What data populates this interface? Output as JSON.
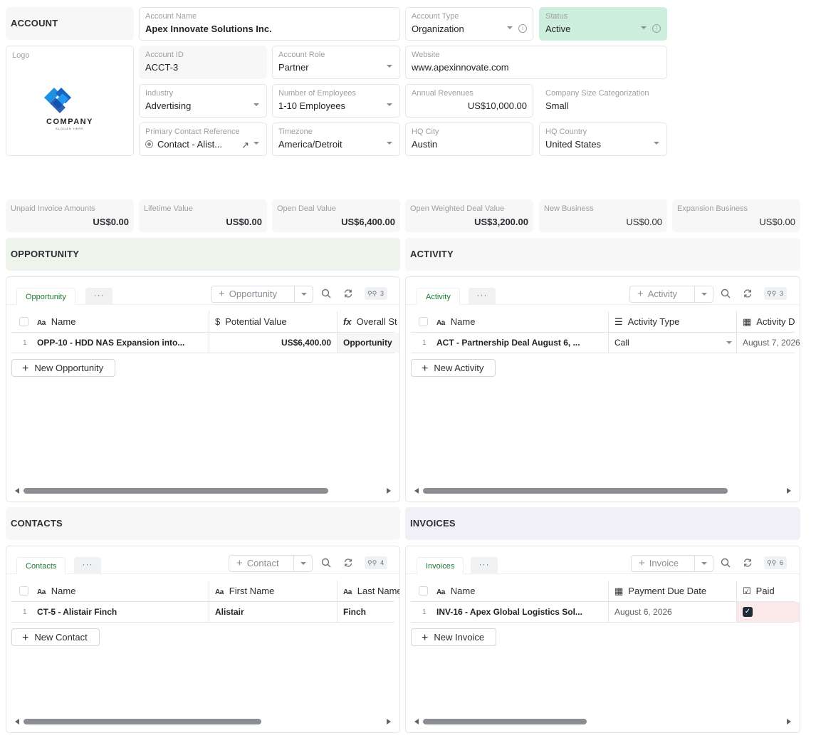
{
  "account": {
    "section_title": "ACCOUNT",
    "account_name": {
      "label": "Account Name",
      "value": "Apex Innovate Solutions Inc."
    },
    "account_type": {
      "label": "Account Type",
      "value": "Organization"
    },
    "status": {
      "label": "Status",
      "value": "Active"
    },
    "logo": {
      "label": "Logo",
      "brand": "COMPANY",
      "slogan": "SLOGAN HERE"
    },
    "account_id": {
      "label": "Account ID",
      "value": "ACCT-3"
    },
    "account_role": {
      "label": "Account Role",
      "value": "Partner"
    },
    "website": {
      "label": "Website",
      "value": "www.apexinnovate.com"
    },
    "industry": {
      "label": "Industry",
      "value": "Advertising"
    },
    "employees": {
      "label": "Number of Employees",
      "value": "1-10 Employees"
    },
    "annual_revenues": {
      "label": "Annual Revenues",
      "value": "US$10,000.00"
    },
    "size_category": {
      "label": "Company Size Categorization",
      "value": "Small"
    },
    "primary_contact": {
      "label": "Primary Contact Reference",
      "value": "Contact - Alist..."
    },
    "timezone": {
      "label": "Timezone",
      "value": "America/Detroit"
    },
    "hq_city": {
      "label": "HQ City",
      "value": "Austin"
    },
    "hq_country": {
      "label": "HQ Country",
      "value": "United States"
    }
  },
  "metrics": [
    {
      "label": "Unpaid Invoice Amounts",
      "value": "US$0.00"
    },
    {
      "label": "Lifetime Value",
      "value": "US$0.00"
    },
    {
      "label": "Open Deal Value",
      "value": "US$6,400.00"
    },
    {
      "label": "Open Weighted Deal Value",
      "value": "US$3,200.00"
    },
    {
      "label": "New Business",
      "value": "US$0.00"
    },
    {
      "label": "Expansion Business",
      "value": "US$0.00"
    }
  ],
  "opportunity": {
    "section_title": "OPPORTUNITY",
    "tab": "Opportunity",
    "more": "···",
    "add_label": "Opportunity",
    "filter_count": "3",
    "columns": [
      "Name",
      "Potential Value",
      "Overall St"
    ],
    "row": {
      "num": "1",
      "name": "OPP-10 - HDD NAS Expansion into...",
      "value": "US$6,400.00",
      "stage": "Opportunity"
    },
    "new_label": "New Opportunity"
  },
  "activity": {
    "section_title": "ACTIVITY",
    "tab": "Activity",
    "more": "···",
    "add_label": "Activity",
    "filter_count": "3",
    "columns": [
      "Name",
      "Activity Type",
      "Activity D"
    ],
    "row": {
      "num": "1",
      "name": "ACT - Partnership Deal August 6, ...",
      "type": "Call",
      "date": "August 7, 2026"
    },
    "new_label": "New Activity"
  },
  "contacts": {
    "section_title": "CONTACTS",
    "tab": "Contacts",
    "more": "···",
    "add_label": "Contact",
    "filter_count": "4",
    "columns": [
      "Name",
      "First Name",
      "Last Name"
    ],
    "row": {
      "num": "1",
      "name": "CT-5 - Alistair Finch",
      "first": "Alistair",
      "last": "Finch"
    },
    "new_label": "New Contact"
  },
  "invoices": {
    "section_title": "INVOICES",
    "tab": "Invoices",
    "more": "···",
    "add_label": "Invoice",
    "filter_count": "6",
    "columns": [
      "Name",
      "Payment Due Date",
      "Paid"
    ],
    "row": {
      "num": "1",
      "name": "INV-16 - Apex Global Logistics Sol...",
      "due": "August 6, 2026"
    },
    "new_label": "New Invoice"
  },
  "colors": {
    "status_bg": "#cdeedd",
    "opportunity_section": "#eef3ec",
    "activity_section": "#f7f7f8",
    "contacts_section": "#f7f7f8",
    "invoices_section": "#f1f0f6",
    "tab_green": "#1e7a34"
  }
}
